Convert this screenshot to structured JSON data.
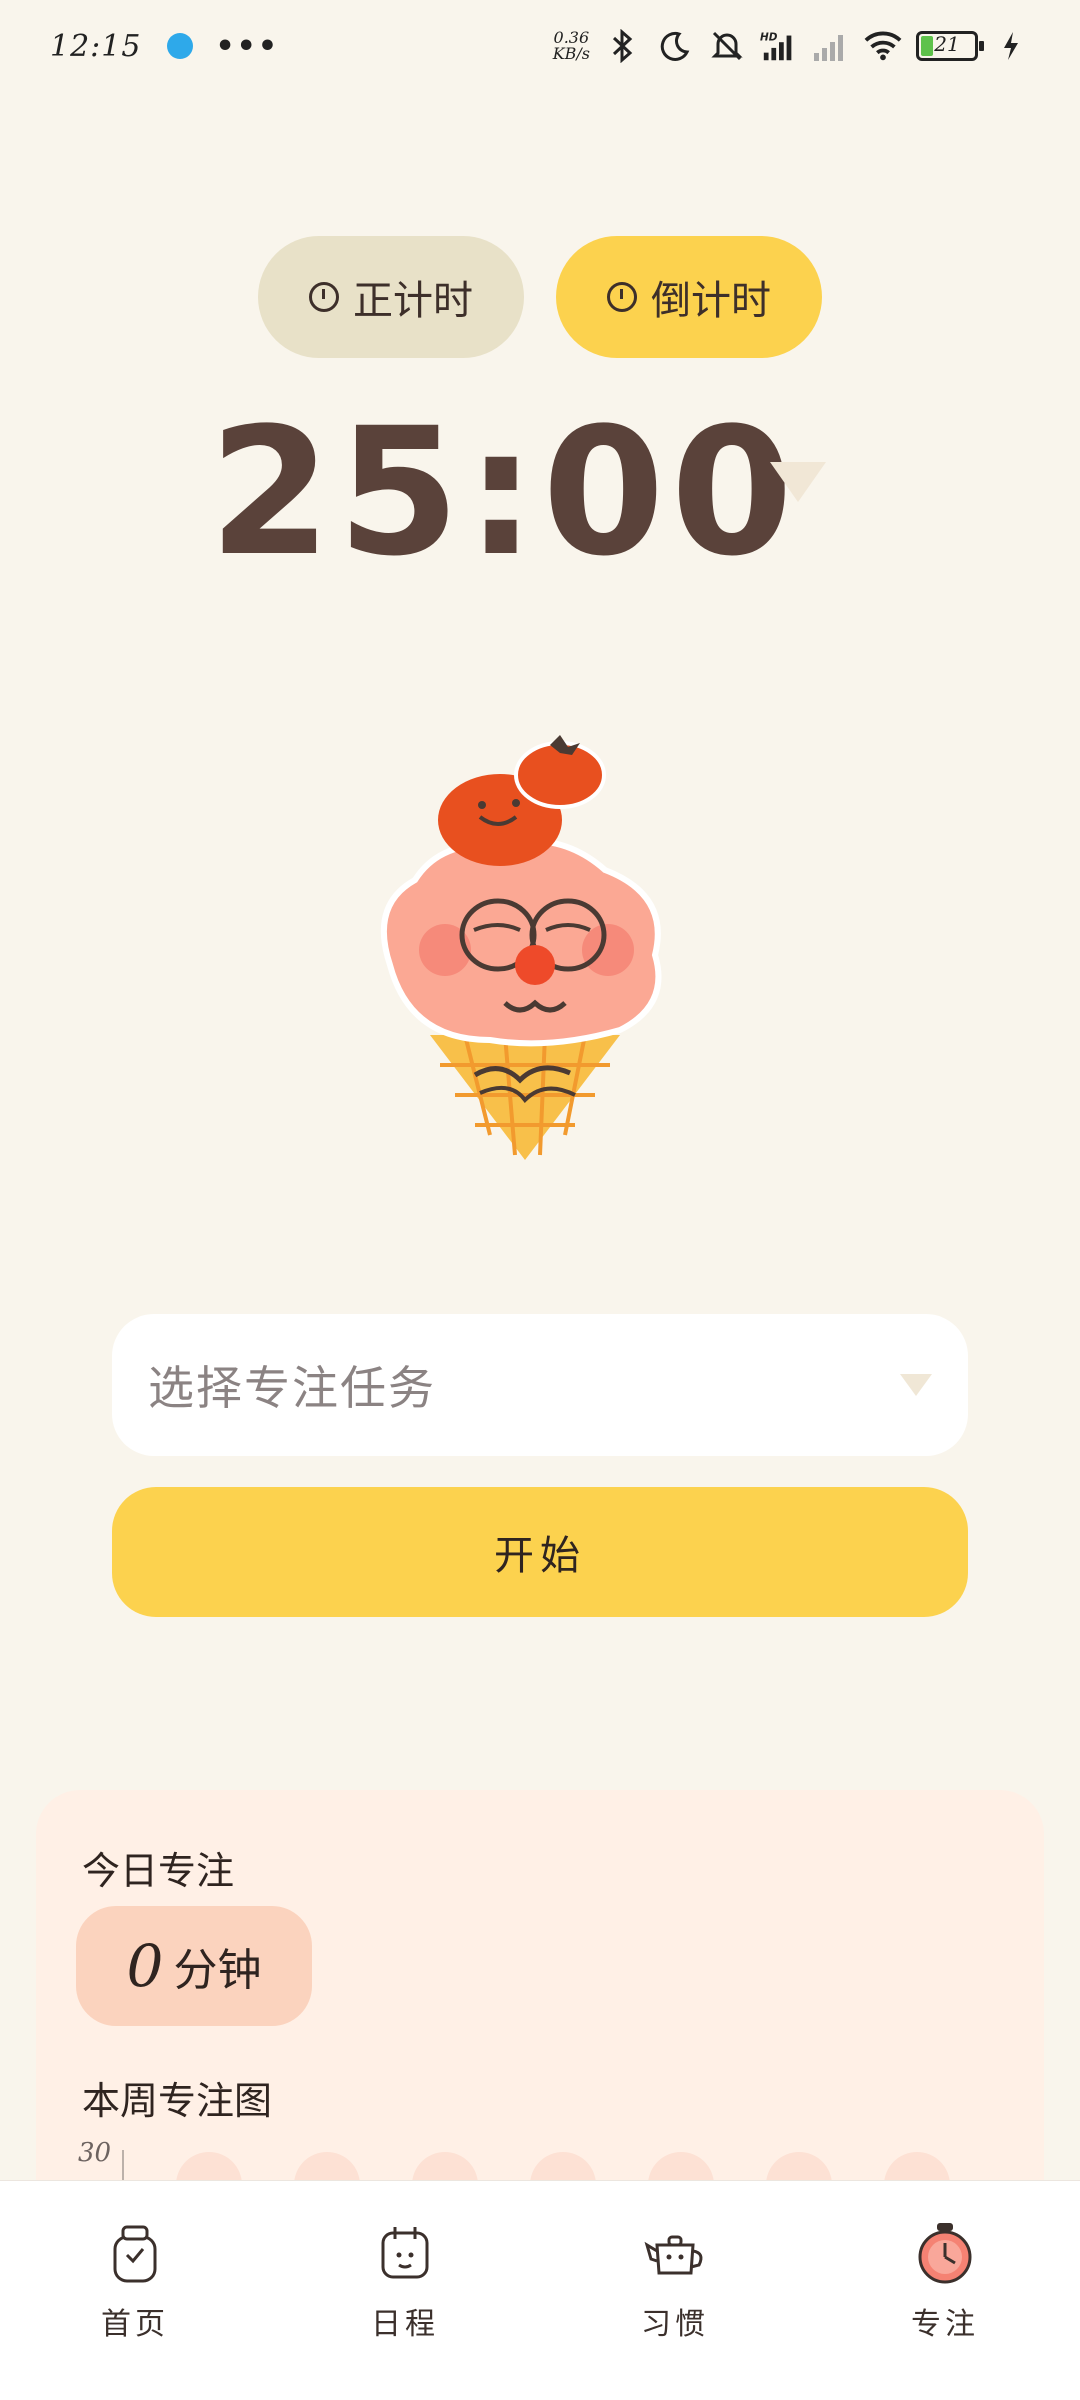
{
  "status_bar": {
    "time": "12:15",
    "more": "•••",
    "net_speed_value": "0.36",
    "net_speed_unit": "KB/s",
    "signal_tag": "HD",
    "battery": "21",
    "icons": [
      "bluetooth-icon",
      "moon-icon",
      "bell-off-icon",
      "signal-icon",
      "signal-weak-icon",
      "wifi-icon",
      "battery-icon",
      "charging-icon"
    ]
  },
  "timer_modes": {
    "count_up": "正计时",
    "count_down": "倒计时",
    "active": "count_down"
  },
  "timer": {
    "display": "25:00"
  },
  "task": {
    "placeholder": "选择专注任务"
  },
  "start_button": "开始",
  "stats": {
    "today_title": "今日专注",
    "today_value": "0",
    "today_unit": "分钟",
    "week_title": "本周专注图",
    "week_chart_ymax": "30"
  },
  "bottom_nav": [
    {
      "label": "首页",
      "icon": "home-jar-icon"
    },
    {
      "label": "日程",
      "icon": "schedule-icon"
    },
    {
      "label": "习惯",
      "icon": "habit-teapot-icon"
    },
    {
      "label": "专注",
      "icon": "focus-timer-icon"
    }
  ],
  "colors": {
    "background": "#f9f5ec",
    "accent_yellow": "#fcd24e",
    "inactive_mode": "#e8e1c8",
    "timer_text": "#5a423a",
    "stats_card": "#fff0e6",
    "today_pill": "#fbd3be"
  }
}
